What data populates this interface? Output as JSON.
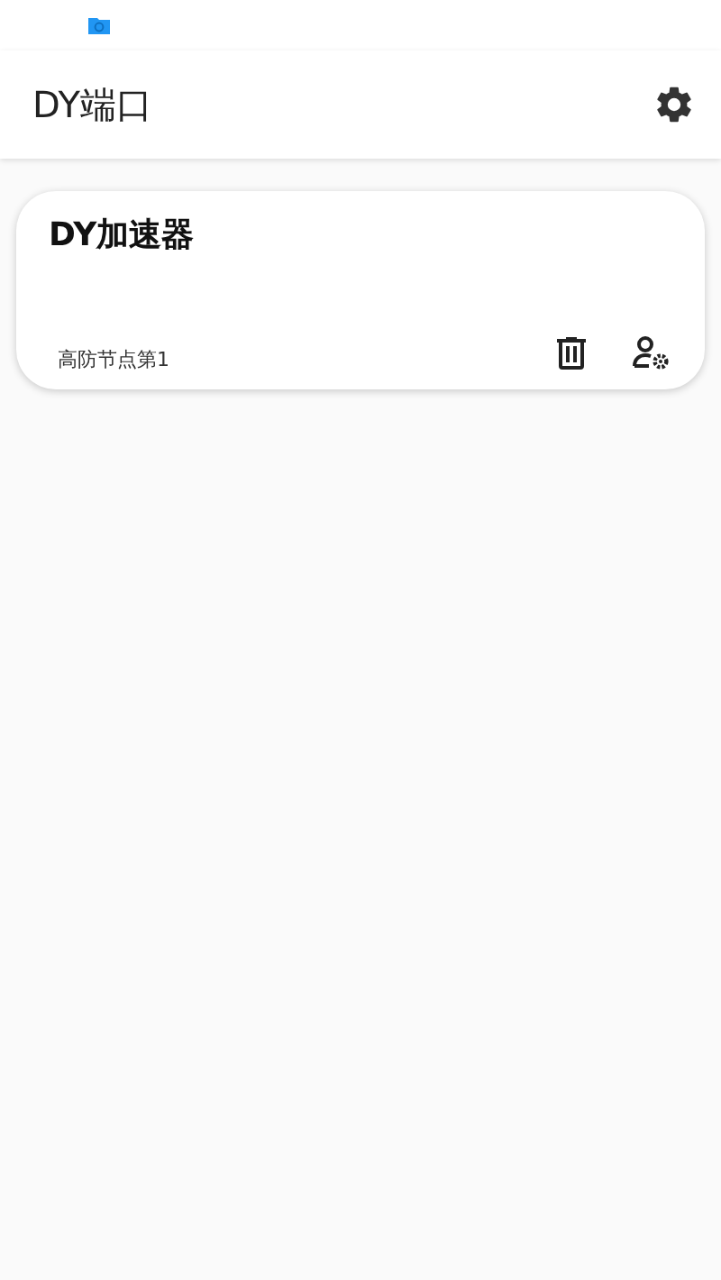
{
  "app_bar": {
    "title": "DY端口"
  },
  "cards": [
    {
      "title": "DY加速器",
      "subtitle": "高防节点第1"
    }
  ]
}
